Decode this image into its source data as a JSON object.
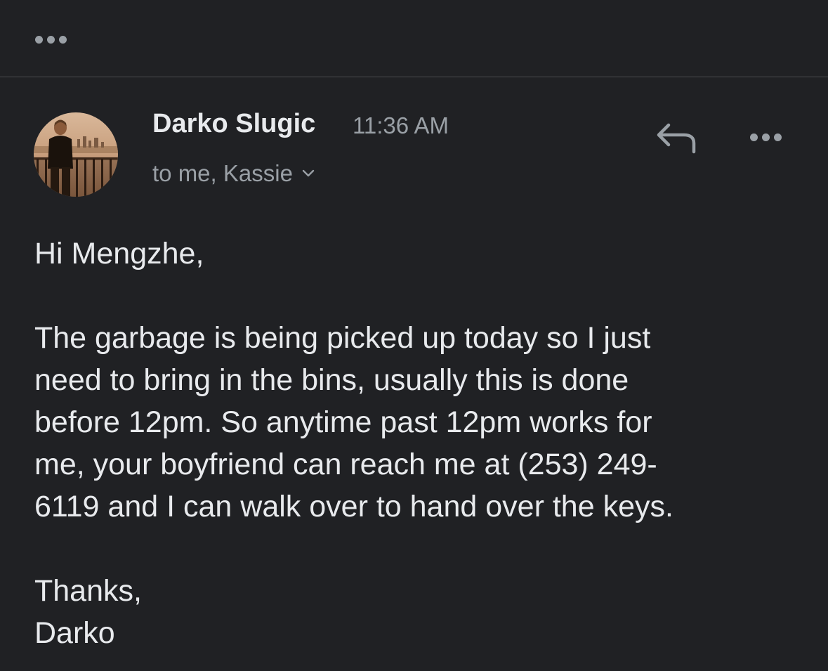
{
  "top_bar": {
    "more_icon": "more-horizontal-icon"
  },
  "message": {
    "sender_name": "Darko Slugic",
    "time": "11:36 AM",
    "recipients": "to me, Kassie",
    "avatar_icon": "profile-photo",
    "reply_icon": "reply-icon",
    "more_icon": "more-horizontal-icon",
    "body": {
      "greeting": "Hi Mengzhe,",
      "paragraph_lines": [
        "The garbage is being picked up today so I just",
        "need to bring in the bins, usually this is done",
        "before 12pm. So anytime past 12pm works for",
        "me, your boyfriend can reach me at (253) 249-",
        "6119 and I can walk over to hand over the keys."
      ],
      "closing": "Thanks,",
      "signature": "Darko"
    }
  },
  "colors": {
    "background": "#202124",
    "primary_text": "#e8eaed",
    "secondary_text": "#9aa0a6",
    "divider": "#4a4b4e"
  }
}
